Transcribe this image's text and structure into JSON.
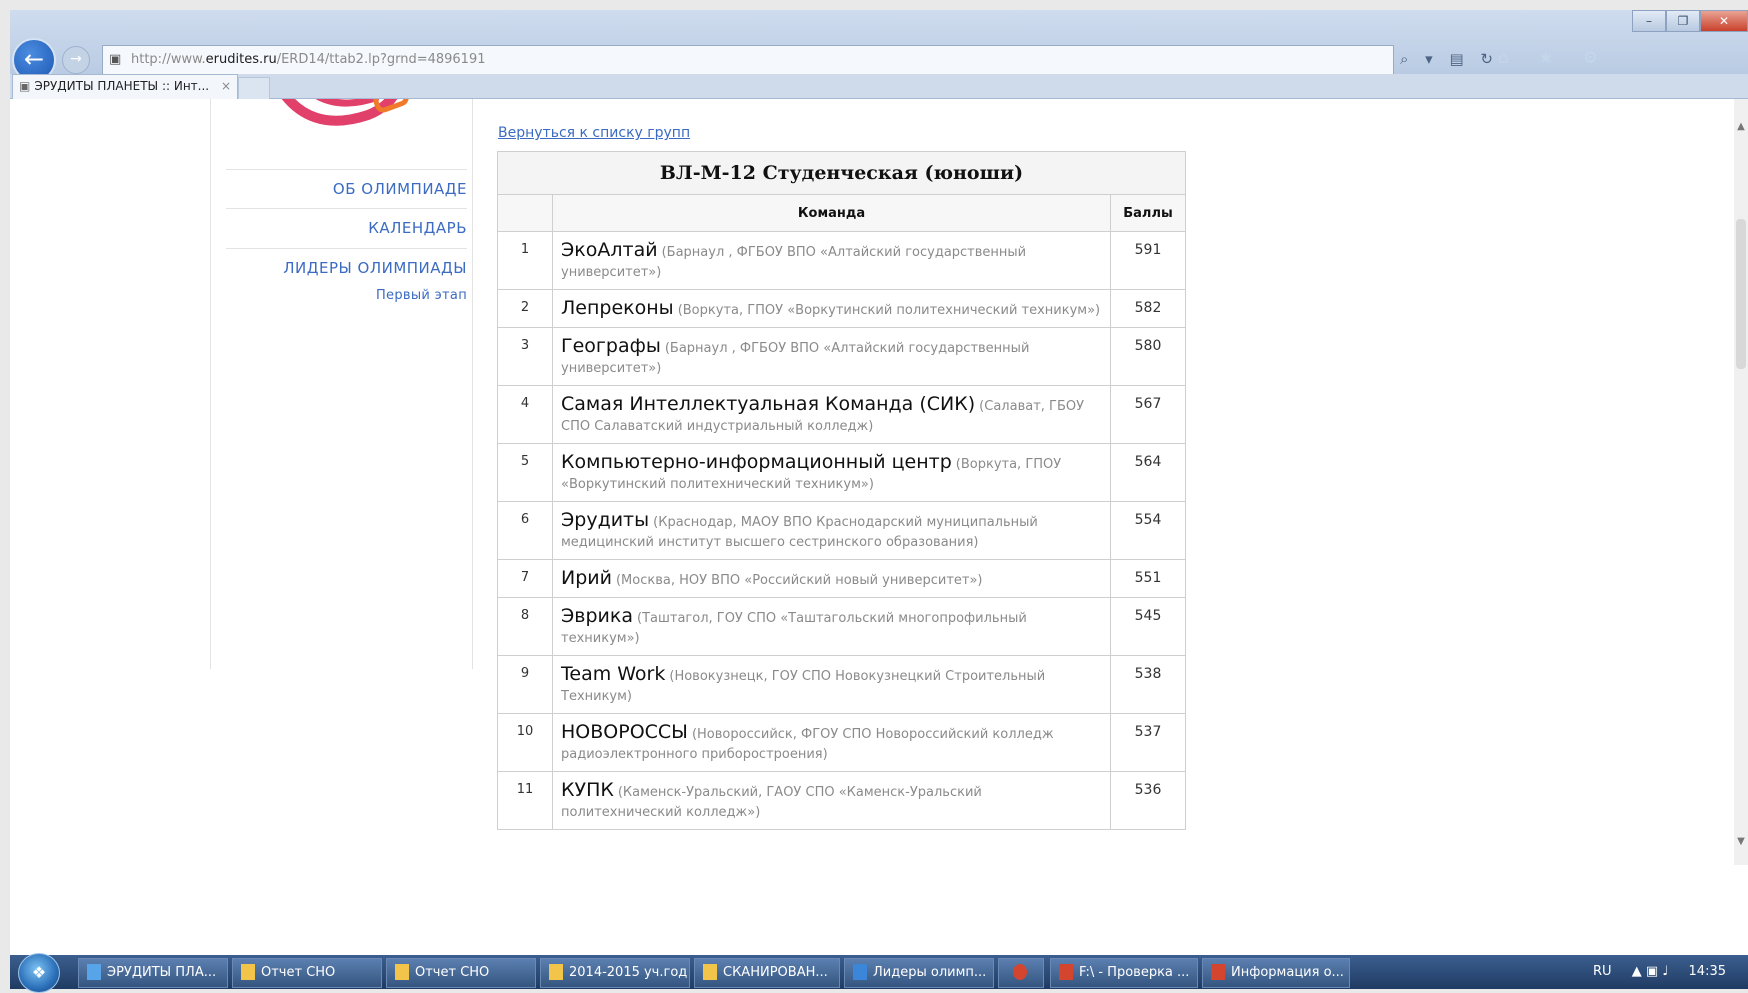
{
  "browser": {
    "url_prefix": "http://www.",
    "url_domain": "erudites.ru",
    "url_path": "/ERD14/ttab2.lp?grnd=4896191",
    "tab_title": "ЭРУДИТЫ ПЛАНЕТЫ :: Инт...",
    "tab_close": "×",
    "window_controls": [
      "–",
      "❐",
      "✕"
    ],
    "address_tools": "⌕ ▾ ▤ ↻",
    "right_tools": "⌂ ★ ⚙"
  },
  "sidebar": {
    "items": [
      {
        "label": "ОБ ОЛИМПИАДЕ"
      },
      {
        "label": "КАЛЕНДАРЬ"
      },
      {
        "label": "ЛИДЕРЫ ОЛИМПИАДЫ"
      }
    ],
    "sub_item": "Первый этап"
  },
  "main": {
    "back_link": "Вернуться к списку групп",
    "table_title": "ВЛ-М-12 Студенческая (юноши)",
    "col_team": "Команда",
    "col_points": "Баллы",
    "rows": [
      {
        "n": "1",
        "name": "ЭкоАлтай",
        "info": "(Барнаул , ФГБОУ ВПО «Алтайский государственный университет»)",
        "points": "591"
      },
      {
        "n": "2",
        "name": "Лепреконы",
        "info": "(Воркута, ГПОУ «Воркутинский политехнический техникум»)",
        "points": "582"
      },
      {
        "n": "3",
        "name": "Географы",
        "info": "(Барнаул , ФГБОУ ВПО «Алтайский государственный университет»)",
        "points": "580"
      },
      {
        "n": "4",
        "name": "Самая Интеллектуальная Команда (СИК)",
        "info": "(Салават, ГБОУ СПО Салаватский индустриальный колледж)",
        "points": "567"
      },
      {
        "n": "5",
        "name": "Компьютерно-информационный центр",
        "info": "(Воркута, ГПОУ «Воркутинский политехнический техникум»)",
        "points": "564"
      },
      {
        "n": "6",
        "name": "Эрудиты",
        "info": "(Краснодар, МАОУ ВПО Краснодарский муниципальный медицинский институт высшего сестринского образования)",
        "points": "554"
      },
      {
        "n": "7",
        "name": "Ирий",
        "info": "(Москва, НОУ ВПО «Российский новый университет»)",
        "points": "551"
      },
      {
        "n": "8",
        "name": "Эврика",
        "info": "(Таштагол, ГОУ СПО «Таштагольский многопрофильный техникум»)",
        "points": "545"
      },
      {
        "n": "9",
        "name": "Team Work",
        "info": "(Новокузнецк, ГОУ СПО Новокузнецкий Строительный Техникум)",
        "points": "538"
      },
      {
        "n": "10",
        "name": "НОВОРОССЫ",
        "info": "(Новороссийск, ФГОУ СПО Новороссийский колледж радиоэлектронного приборостроения)",
        "points": "537"
      },
      {
        "n": "11",
        "name": "КУПК",
        "info": "(Каменск-Уральский, ГАОУ СПО «Каменск-Уральский политехнический колледж»)",
        "points": "536"
      }
    ]
  },
  "taskbar": {
    "items": [
      {
        "label": "ЭРУДИТЫ ПЛА...",
        "icon": "ie-icon"
      },
      {
        "label": "Отчет СНО",
        "icon": "folder-icon"
      },
      {
        "label": "Отчет СНО",
        "icon": "folder-icon"
      },
      {
        "label": "2014-2015 уч.год",
        "icon": "folder-icon"
      },
      {
        "label": "СКАНИРОВАН...",
        "icon": "folder-icon"
      },
      {
        "label": "Лидеры олимп...",
        "icon": "word-icon"
      },
      {
        "label": "F:\\ - Проверка ...",
        "icon": "app-icon"
      },
      {
        "label": "Информация о...",
        "icon": "ppt-icon"
      }
    ],
    "lang": "RU",
    "time": "14:35"
  }
}
